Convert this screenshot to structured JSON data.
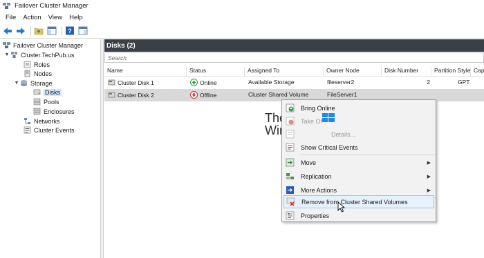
{
  "window": {
    "title": "Failover Cluster Manager"
  },
  "menubar": [
    "File",
    "Action",
    "View",
    "Help"
  ],
  "tree": {
    "root": "Failover Cluster Manager",
    "cluster": "Cluster.TechPub.us",
    "roles": "Roles",
    "nodes": "Nodes",
    "storage": "Storage",
    "disks": "Disks",
    "pools": "Pools",
    "enclosures": "Enclosures",
    "networks": "Networks",
    "cluster_events": "Cluster Events"
  },
  "main": {
    "header": "Disks (2)",
    "search_placeholder": "Search",
    "columns": [
      "Name",
      "Status",
      "Assigned To",
      "Owner Node",
      "Disk Number",
      "Partition Style",
      "Cap"
    ],
    "rows": [
      {
        "name": "Cluster Disk 1",
        "status": "Online",
        "assigned_to": "Available Storage",
        "owner_node": "fileserver2",
        "disk_number": "2",
        "partition_style": "GPT"
      },
      {
        "name": "Cluster Disk 2",
        "status": "Offline",
        "assigned_to": "Cluster Shared Volume",
        "owner_node": "FileServer1",
        "disk_number": "",
        "partition_style": ""
      }
    ]
  },
  "context_menu": {
    "items": [
      {
        "label": "Bring Online",
        "icon": "bring-online-icon"
      },
      {
        "label": "Take Of",
        "icon": "take-offline-icon"
      },
      {
        "label": "Details...",
        "icon": "details-icon"
      },
      {
        "label": "Show Critical Events",
        "icon": "critical-events-icon"
      },
      {
        "label": "Move",
        "icon": "move-icon"
      },
      {
        "label": "Replication",
        "icon": "replication-icon"
      },
      {
        "label": "More Actions",
        "icon": "more-actions-icon"
      },
      {
        "label": "Remove from Cluster Shared Volumes",
        "icon": "remove-csv-icon"
      },
      {
        "label": "Properties",
        "icon": "properties-icon"
      }
    ]
  },
  "watermark": {
    "line1": "The",
    "line2": "WindowsClub"
  },
  "colors": {
    "header_bg": "#3b3f47",
    "selection": "#cce8ff",
    "menu_hover": "#e5f1fb",
    "online": "#2e9e3a",
    "offline": "#d32f2f"
  }
}
